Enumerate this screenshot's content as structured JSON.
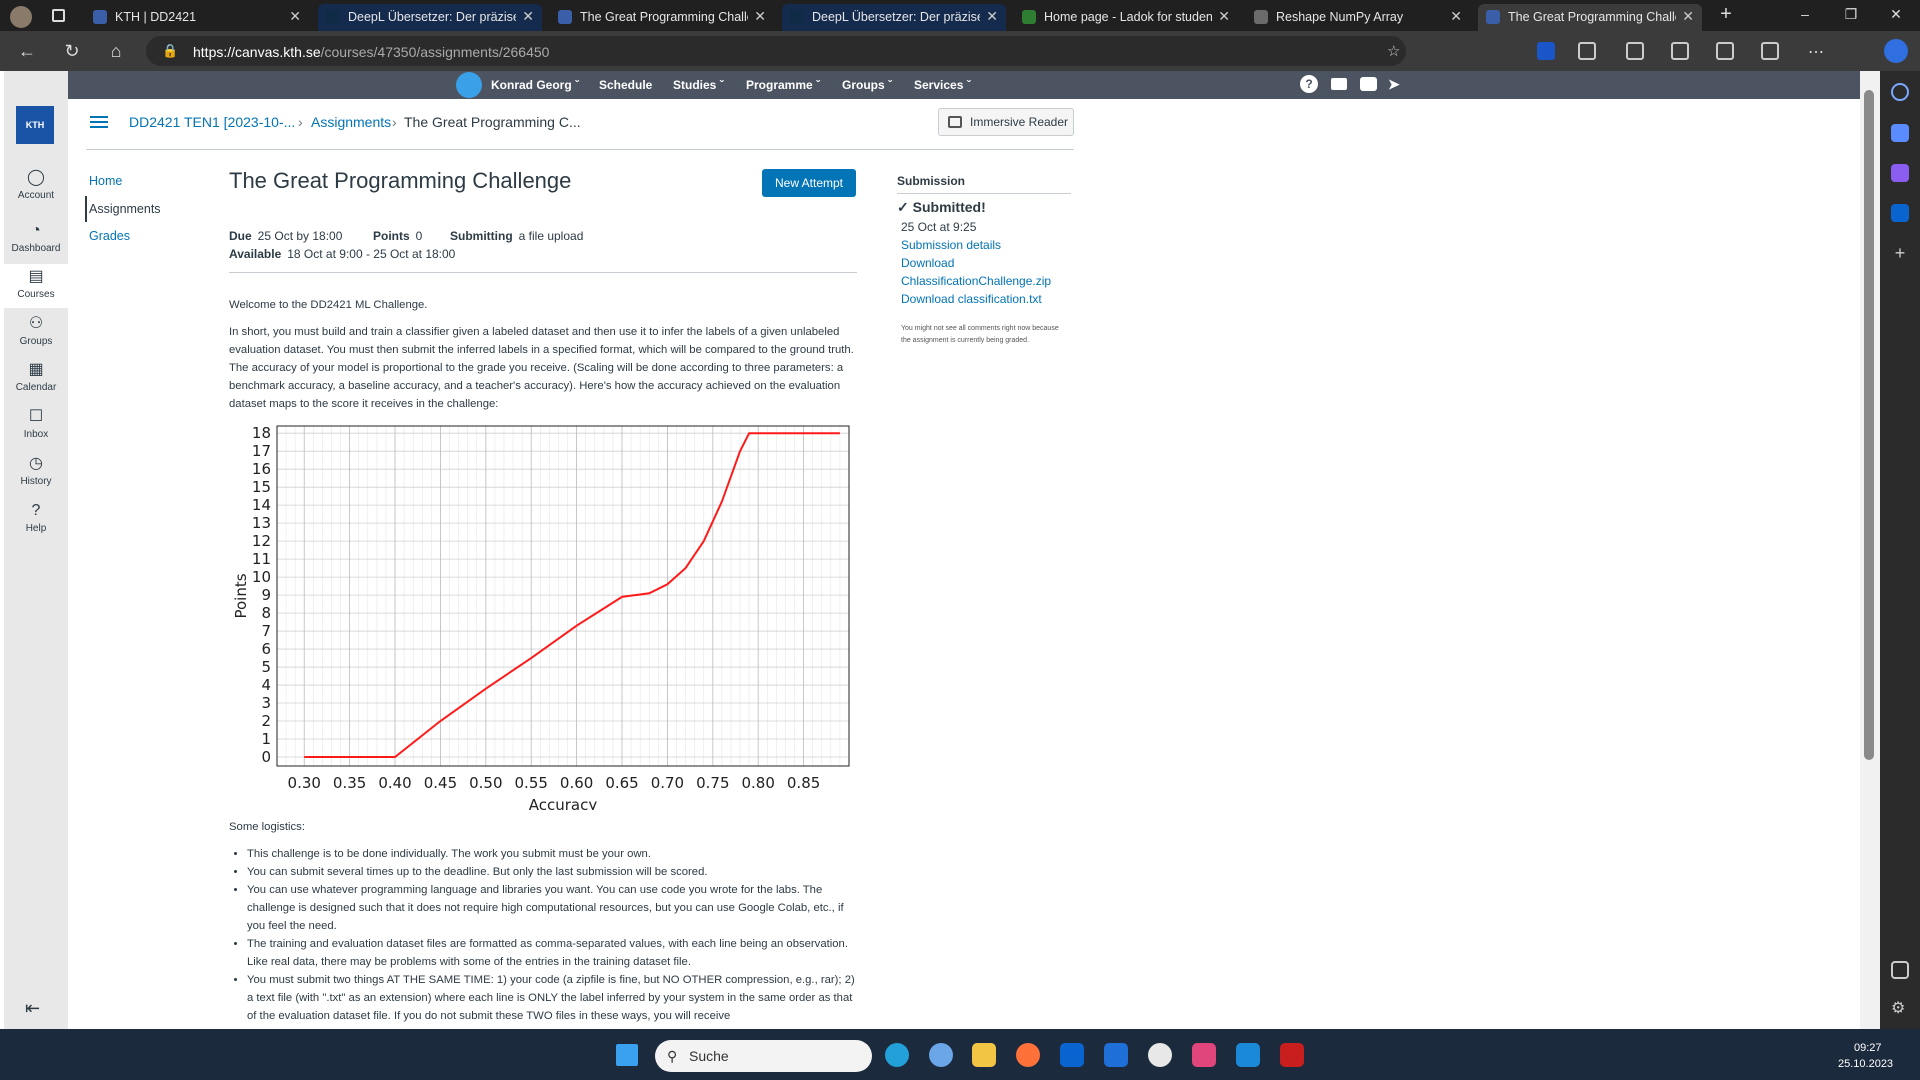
{
  "tabs": [
    {
      "title": "KTH | DD2421",
      "active": false,
      "favicon_color": "#3a5fa8"
    },
    {
      "title": "DeepL Übersetzer: Der präzises",
      "active": false,
      "favicon_color": "#0f2b46"
    },
    {
      "title": "The Great Programming Challe",
      "active": false,
      "favicon_color": "#3a5fa8"
    },
    {
      "title": "DeepL Übersetzer: Der präzises",
      "active": false,
      "favicon_color": "#0f2b46"
    },
    {
      "title": "Home page - Ladok for student",
      "active": false,
      "favicon_color": "#2e7d32"
    },
    {
      "title": "Reshape NumPy Array",
      "active": false,
      "favicon_color": "#6b6b6b"
    },
    {
      "title": "The Great Programming Challe",
      "active": true,
      "favicon_color": "#3a5fa8"
    }
  ],
  "address": {
    "host": "https://canvas.kth.se",
    "path": "/courses/47350/assignments/266450"
  },
  "topmenu": {
    "user": "Konrad Georg",
    "schedule": "Schedule",
    "studies": "Studies",
    "programme": "Programme",
    "groups": "Groups",
    "services": "Services"
  },
  "globalnav": [
    {
      "label": "Account",
      "icon": "avatar-icon"
    },
    {
      "label": "Dashboard",
      "icon": "dashboard-icon"
    },
    {
      "label": "Courses",
      "icon": "courses-icon"
    },
    {
      "label": "Groups",
      "icon": "groups-icon"
    },
    {
      "label": "Calendar",
      "icon": "calendar-icon"
    },
    {
      "label": "Inbox",
      "icon": "inbox-icon"
    },
    {
      "label": "History",
      "icon": "history-icon"
    },
    {
      "label": "Help",
      "icon": "help-icon"
    }
  ],
  "logo_text": "KTH",
  "breadcrumb": {
    "course": "DD2421 TEN1 [2023-10-...",
    "assignments": "Assignments",
    "current": "The Great Programming C..."
  },
  "immersive_reader": "Immersive Reader",
  "course_nav": [
    "Home",
    "Assignments",
    "Grades"
  ],
  "assignment": {
    "title": "The Great Programming Challenge",
    "new_attempt": "New Attempt",
    "due_label": "Due",
    "due": "25 Oct by 18:00",
    "points_label": "Points",
    "points": "0",
    "submitting_label": "Submitting",
    "submitting": "a file upload",
    "available_label": "Available",
    "available": "18 Oct at 9:00 - 25 Oct at 18:00",
    "welcome": "Welcome to the DD2421 ML Challenge.",
    "intro": "In short, you must build and train a classifier given a labeled dataset and then use it to infer the labels of a given unlabeled evaluation dataset. You must then submit the inferred labels in a specified format, which will be compared to the ground truth. The accuracy of your model is proportional to the grade you receive. (Scaling will be done according to three parameters: a benchmark accuracy, a baseline accuracy, and a teacher's accuracy). Here's how the accuracy achieved on the evaluation dataset maps to the score it receives in the challenge:",
    "logistics_title": "Some logistics:",
    "logistics": [
      "This challenge is to be done individually. The work you submit must be your own.",
      "You can submit several times up to the deadline. But only the last submission will be scored.",
      "You can use whatever programming language and libraries you want.  You can use code you wrote for the labs. The challenge is designed such that it does not require high computational resources, but you can use Google Colab, etc., if you feel the need.",
      "The training and evaluation dataset files are formatted as comma-separated values, with each line being an observation. Like real data, there may be problems with some of the entries in the training dataset file.",
      "You must submit two things AT THE SAME TIME: 1) your code (a zipfile is fine, but NO OTHER compression, e.g., rar); 2) a text file (with \".txt\" as an extension) where each line is ONLY the label inferred by your system in the same order as that of the evaluation dataset file. If you do not submit these TWO files in these ways, you will receive"
    ]
  },
  "submission": {
    "heading": "Submission",
    "status": "Submitted!",
    "date": "25 Oct at 9:25",
    "details": "Submission details",
    "download": "Download",
    "file1": "ChlassificationChallenge.zip",
    "file2": "Download classification.txt",
    "note": "You might not see all comments right now because the assignment is currently being graded."
  },
  "chart_data": {
    "type": "line",
    "xlabel": "Accuracy",
    "ylabel": "Points",
    "xlim": [
      0.27,
      0.9
    ],
    "ylim": [
      -0.5,
      18.4
    ],
    "xticks": [
      "0.30",
      "0.35",
      "0.40",
      "0.45",
      "0.50",
      "0.55",
      "0.60",
      "0.65",
      "0.70",
      "0.75",
      "0.80",
      "0.85"
    ],
    "yticks": [
      "0",
      "1",
      "2",
      "3",
      "4",
      "5",
      "6",
      "7",
      "8",
      "9",
      "10",
      "11",
      "12",
      "13",
      "14",
      "15",
      "16",
      "17",
      "18"
    ],
    "grid": true,
    "color": "#ff1a1a",
    "x": [
      0.3,
      0.35,
      0.4,
      0.45,
      0.5,
      0.55,
      0.6,
      0.65,
      0.68,
      0.7,
      0.72,
      0.74,
      0.76,
      0.78,
      0.79,
      0.82,
      0.85,
      0.89
    ],
    "y": [
      0,
      0,
      0,
      2,
      3.8,
      5.5,
      7.3,
      8.9,
      9.1,
      9.6,
      10.5,
      12.0,
      14.2,
      17.0,
      18,
      18,
      18,
      18
    ]
  },
  "taskbar": {
    "search": "Suche",
    "time": "09:27",
    "date": "25.10.2023"
  }
}
